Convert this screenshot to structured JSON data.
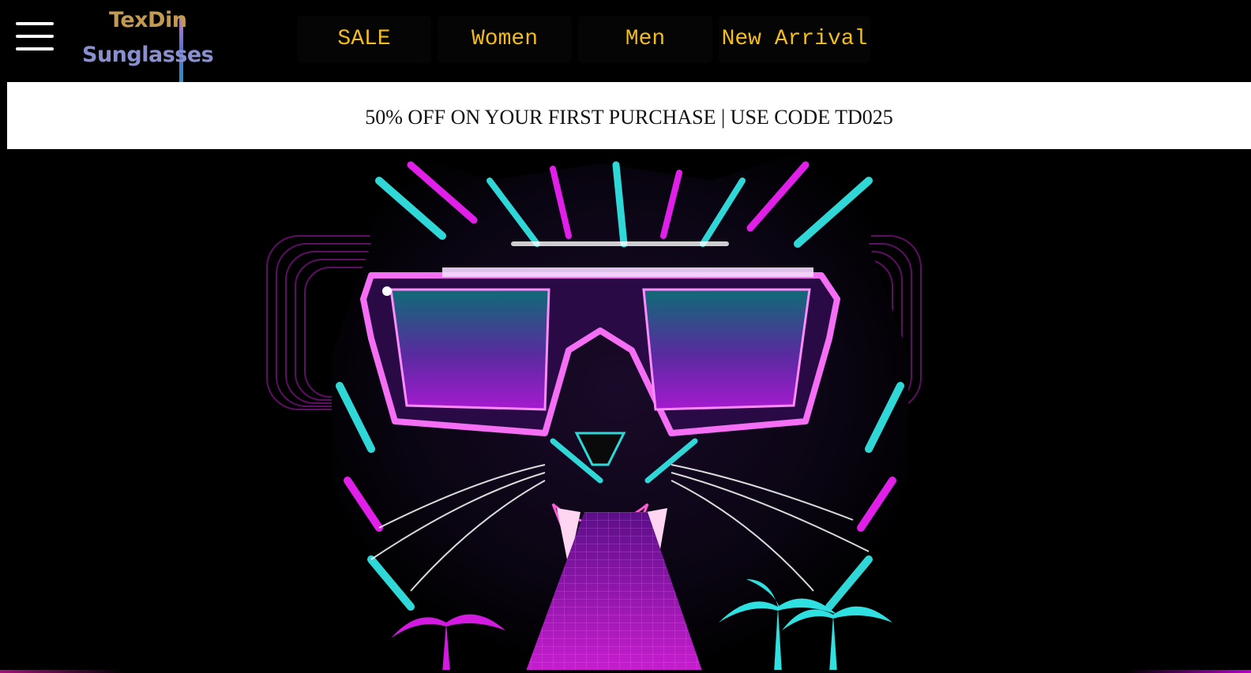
{
  "header": {
    "logo": {
      "line1": "TexDin",
      "line2": "Sunglasses"
    },
    "nav": [
      {
        "label": "SALE"
      },
      {
        "label": "Women"
      },
      {
        "label": "Men"
      },
      {
        "label": "New Arrival"
      }
    ]
  },
  "promo": {
    "text": "50% OFF ON YOUR FIRST PURCHASE | USE CODE TD025"
  },
  "hero": {
    "image": "neon tiger wearing sunglasses",
    "colors": {
      "magenta": "#e020e8",
      "cyan": "#2fd7d7",
      "purple": "#6a18c8",
      "teal_lens": "#0f6f7a",
      "nav_text": "#f2bc1b"
    }
  }
}
